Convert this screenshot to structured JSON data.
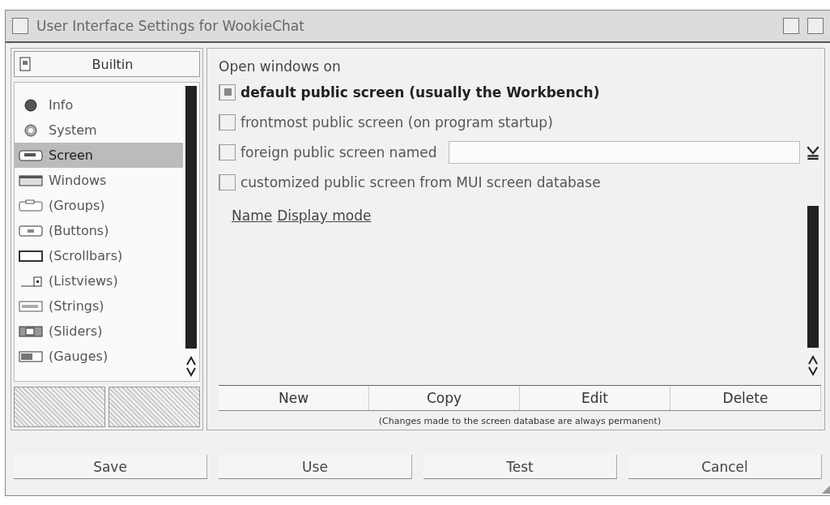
{
  "window": {
    "title": "User Interface Settings for WookieChat"
  },
  "sidebar": {
    "header": "Builtin",
    "items": [
      {
        "label": "Info",
        "selected": false
      },
      {
        "label": "System",
        "selected": false
      },
      {
        "label": "Screen",
        "selected": true
      },
      {
        "label": "Windows",
        "selected": false
      },
      {
        "label": "(Groups)",
        "selected": false
      },
      {
        "label": "(Buttons)",
        "selected": false
      },
      {
        "label": "(Scrollbars)",
        "selected": false
      },
      {
        "label": "(Listviews)",
        "selected": false
      },
      {
        "label": "(Strings)",
        "selected": false
      },
      {
        "label": "(Sliders)",
        "selected": false
      },
      {
        "label": "(Gauges)",
        "selected": false
      }
    ]
  },
  "screen_panel": {
    "heading": "Open windows on",
    "options": [
      {
        "label": "default public screen (usually the Workbench)",
        "selected": true
      },
      {
        "label": "frontmost public screen (on program startup)",
        "selected": false
      },
      {
        "label": "foreign public screen named",
        "selected": false,
        "kind": "field"
      },
      {
        "label": "customized public screen from MUI screen database",
        "selected": false
      }
    ],
    "list_columns": [
      "Name",
      "Display mode"
    ],
    "list_buttons": [
      "New",
      "Copy",
      "Edit",
      "Delete"
    ],
    "note": "(Changes made to the screen database are always permanent)"
  },
  "buttons": [
    "Save",
    "Use",
    "Test",
    "Cancel"
  ]
}
